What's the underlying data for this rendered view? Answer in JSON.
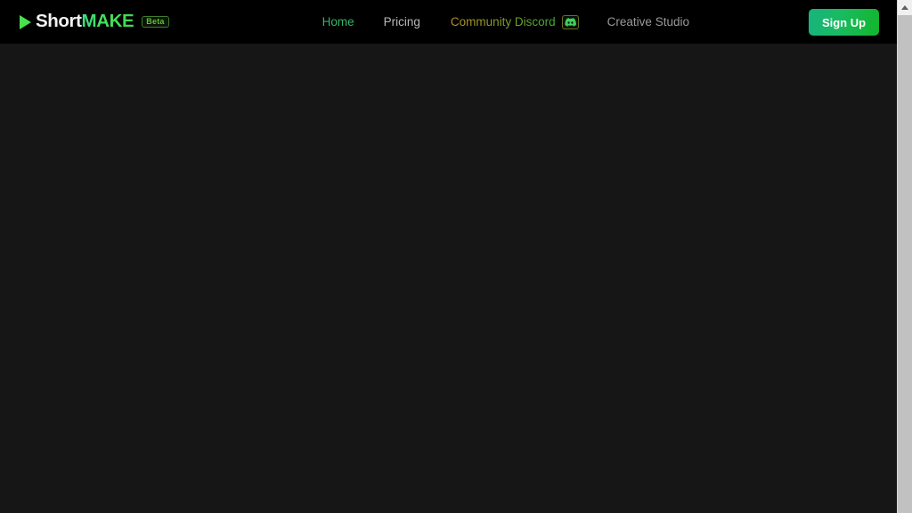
{
  "brand": {
    "play_icon": "play-triangle-icon",
    "name_part_1": "Short",
    "name_part_2": "MAKE",
    "badge_label": "Beta",
    "accent_green": "#3ed94d",
    "badge_border": "#3f7d2c"
  },
  "nav": {
    "items": [
      {
        "label": "Home",
        "state": "active",
        "color": "#34b56a"
      },
      {
        "label": "Pricing",
        "state": "default",
        "color": "#b9b9b9"
      },
      {
        "label": "Community Discord",
        "state": "default",
        "color": "#8f9a24",
        "icon": "discord-icon"
      },
      {
        "label": "Creative Studio",
        "state": "default",
        "color": "#9a9a9a"
      }
    ]
  },
  "actions": {
    "signup_label": "Sign Up",
    "signup_gradient_from": "#18b37e",
    "signup_gradient_to": "#13b52c"
  },
  "page": {
    "background": "#161616",
    "header_background": "#000000",
    "content": ""
  },
  "scrollbar": {
    "up_arrow_icon": "scroll-up-arrow-icon",
    "down_arrow_icon": "scroll-down-arrow-icon",
    "thumb_color": "#c1c1c1",
    "track_color": "#f0f0f0"
  }
}
